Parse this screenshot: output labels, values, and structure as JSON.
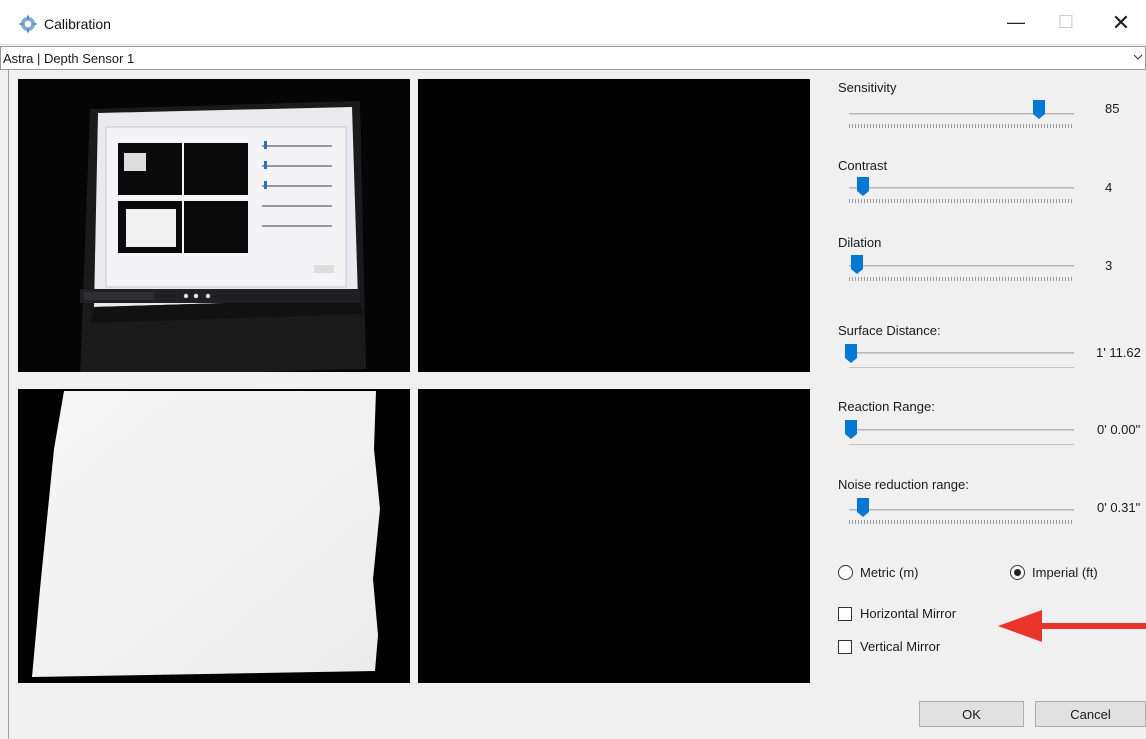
{
  "window": {
    "title": "Calibration",
    "minimize_glyph": "—",
    "maximize_glyph": "☐",
    "close_glyph": "✕"
  },
  "device_select": {
    "value": "Astra | Depth Sensor 1"
  },
  "preview_panels": [
    {
      "name": "color-camera-view",
      "content": "color-image"
    },
    {
      "name": "depth-view",
      "content": "blank"
    },
    {
      "name": "surface-mask-view",
      "content": "white-mask"
    },
    {
      "name": "touch-view",
      "content": "blank"
    }
  ],
  "controls": {
    "sensitivity": {
      "label": "Sensitivity",
      "value": "85",
      "level": 0.85
    },
    "contrast": {
      "label": "Contrast",
      "value": "4",
      "level": 0.05
    },
    "dilation": {
      "label": "Dilation",
      "value": "3",
      "level": 0.03
    },
    "surface_distance": {
      "label": "Surface Distance:",
      "value": "1' 11.62",
      "level": 0.0
    },
    "reaction_range": {
      "label": "Reaction Range:",
      "value": "0' 0.00\"",
      "level": 0.0
    },
    "noise_reduction_range": {
      "label": "Noise reduction range:",
      "value": "0' 0.31\"",
      "level": 0.05
    }
  },
  "units": {
    "metric_label": "Metric (m)",
    "imperial_label": "Imperial (ft)",
    "selected": "imperial"
  },
  "mirror": {
    "horizontal_label": "Horizontal Mirror",
    "vertical_label": "Vertical Mirror",
    "horizontal_checked": false,
    "vertical_checked": false
  },
  "buttons": {
    "ok": "OK",
    "cancel": "Cancel"
  },
  "colors": {
    "accent": "#0078d7",
    "annotation_arrow": "#e8342a",
    "panel_background": "#000000"
  }
}
